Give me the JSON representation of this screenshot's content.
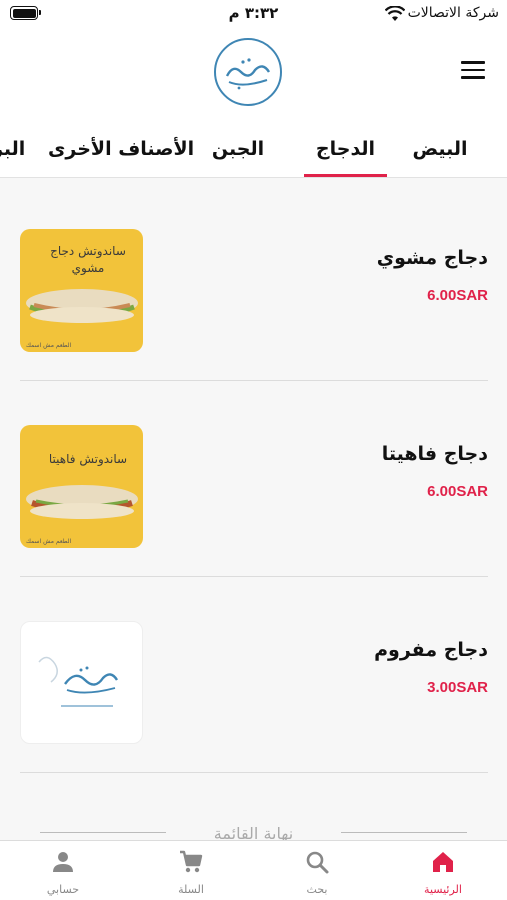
{
  "status_bar": {
    "time": "٣:٣٢ م",
    "carrier": "شركة الاتصالات"
  },
  "header": {
    "logo_text": "خبزة"
  },
  "tabs": [
    {
      "label": "البيض",
      "active": false
    },
    {
      "label": "الدجاج",
      "active": true
    },
    {
      "label": "الجبن",
      "active": false
    },
    {
      "label": "الأصناف الأخرى",
      "active": false
    },
    {
      "label": "البر",
      "active": false
    }
  ],
  "items": [
    {
      "title": "دجاج مشوي",
      "price": "6.00SAR",
      "image_caption": "ساندوتش دجاج مشوي",
      "image_style": "yellow"
    },
    {
      "title": "دجاج فاهيتا",
      "price": "6.00SAR",
      "image_caption": "ساندوتش فاهيتا",
      "image_style": "yellow"
    },
    {
      "title": "دجاج مفروم",
      "price": "3.00SAR",
      "image_caption": "خبزة",
      "image_style": "white"
    }
  ],
  "end_of_list": "نهاية القائمة",
  "bottom_nav": [
    {
      "label": "الرئيسية",
      "icon": "home-icon",
      "active": true
    },
    {
      "label": "بحث",
      "icon": "search-icon",
      "active": false
    },
    {
      "label": "السلة",
      "icon": "cart-icon",
      "active": false
    },
    {
      "label": "حسابي",
      "icon": "person-icon",
      "active": false
    }
  ],
  "colors": {
    "accent": "#e0224a",
    "logo_blue": "#3f86b4",
    "product_yellow": "#f2c33a"
  }
}
